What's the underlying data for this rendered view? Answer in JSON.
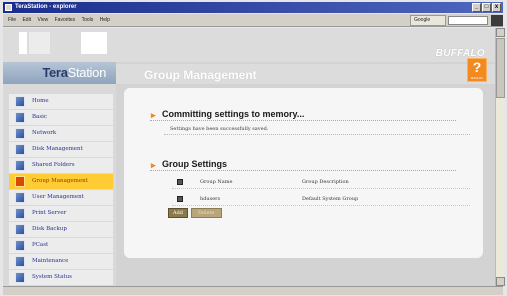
{
  "window": {
    "title": "TeraStation - explorer",
    "buttons": [
      "_",
      "□",
      "x"
    ]
  },
  "menubar": {
    "items": [
      "File",
      "Edit",
      "View",
      "Favorites",
      "Tools",
      "Help"
    ],
    "go_label": "Google"
  },
  "brand": {
    "logo_prefix": "Tera",
    "logo_suffix": "Station",
    "vendor": "BUFFALO"
  },
  "sidebar": {
    "items": [
      {
        "label": "Home",
        "icon": "home-icon",
        "active": false
      },
      {
        "label": "Basic",
        "icon": "basic-icon",
        "active": false
      },
      {
        "label": "Network",
        "icon": "network-icon",
        "active": false
      },
      {
        "label": "Disk Management",
        "icon": "disk-icon",
        "active": false
      },
      {
        "label": "Shared Folders",
        "icon": "folder-icon",
        "active": false
      },
      {
        "label": "Group Management",
        "icon": "group-icon",
        "active": true
      },
      {
        "label": "User Management",
        "icon": "user-icon",
        "active": false
      },
      {
        "label": "Print Server",
        "icon": "printer-icon",
        "active": false
      },
      {
        "label": "Disk Backup",
        "icon": "backup-icon",
        "active": false
      },
      {
        "label": "PCast",
        "icon": "pcast-icon",
        "active": false
      },
      {
        "label": "Maintenance",
        "icon": "maintenance-icon",
        "active": false
      },
      {
        "label": "System Status",
        "icon": "status-icon",
        "active": false
      }
    ]
  },
  "page": {
    "title": "Group Management",
    "help_label": "MANUAL"
  },
  "commit": {
    "heading": "Committing settings to memory...",
    "message": "Settings have been successfully saved."
  },
  "groups": {
    "heading": "Group Settings",
    "columns": [
      "Group Name",
      "Group Description"
    ],
    "rows": [
      {
        "name": "hdusers",
        "description": "Default System Group"
      }
    ],
    "add_label": "Add",
    "delete_label": "Delete"
  },
  "colors": {
    "accent": "#f28a1f",
    "active_nav": "#ffcc33",
    "nav_text": "#23308f"
  }
}
